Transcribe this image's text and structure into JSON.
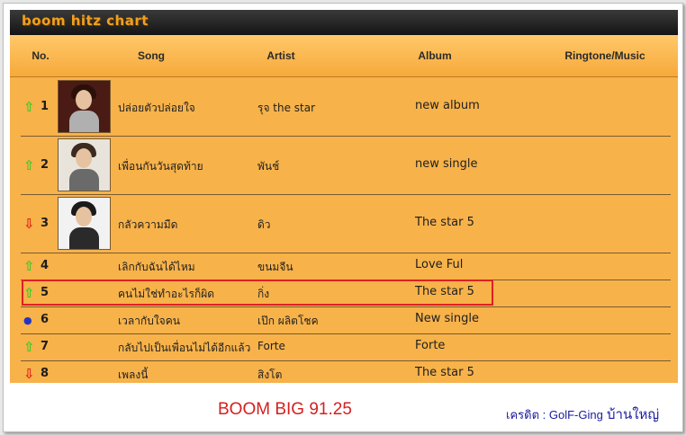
{
  "chart": {
    "title": "boom hitz chart",
    "headers": {
      "no": "No.",
      "song": "Song",
      "artist": "Artist",
      "album": "Album",
      "ringtone": "Ringtone/Music"
    },
    "rows": [
      {
        "trend": "up",
        "trend_glyph": "⇧",
        "rank": "1",
        "song": "ปล่อยตัวปล่อยใจ",
        "artist": "รุจ the star",
        "album": "new album",
        "has_photo": true,
        "photo_icon": "artist-photo"
      },
      {
        "trend": "up",
        "trend_glyph": "⇧",
        "rank": "2",
        "song": "เพื่อนกันวันสุดท้าย",
        "artist": "พันช์",
        "album": "new single",
        "has_photo": true,
        "photo_icon": "artist-photo"
      },
      {
        "trend": "down",
        "trend_glyph": "⇩",
        "rank": "3",
        "song": "กลัวความมืด",
        "artist": "ดิว",
        "album": "The star 5",
        "has_photo": true,
        "photo_icon": "artist-photo"
      },
      {
        "trend": "up",
        "trend_glyph": "⇧",
        "rank": "4",
        "song": "เลิกกับฉันได้ไหม",
        "artist": "ขนมจีน",
        "album": "Love Ful",
        "has_photo": false
      },
      {
        "trend": "up",
        "trend_glyph": "⇧",
        "rank": "5",
        "song": "คนไม่ใช่ทำอะไรก็ผิด",
        "artist": "กิ่ง",
        "album": "The star 5",
        "has_photo": false
      },
      {
        "trend": "same",
        "trend_glyph": "●",
        "rank": "6",
        "song": "เวลากับใจคน",
        "artist": "เป๊ก ผลิตโชค",
        "album": "New single",
        "has_photo": false
      },
      {
        "trend": "up",
        "trend_glyph": "⇧",
        "rank": "7",
        "song": "กลับไปเป็นเพื่อนไม่ได้อีกแล้ว",
        "artist": "Forte",
        "album": "Forte",
        "has_photo": false
      },
      {
        "trend": "down",
        "trend_glyph": "⇩",
        "rank": "8",
        "song": "เพลงนี้",
        "artist": "สิงโต",
        "album": "The star 5",
        "has_photo": false
      }
    ]
  },
  "footer": {
    "station": "BOOM BIG 91.25",
    "credit_label": "เครดิต",
    "credit_sep": " : ",
    "credit_name": "GolF-Ging",
    "credit_place": " บ้านใหญ่"
  },
  "colors": {
    "trend_up": "#44c828",
    "trend_down": "#e2281a",
    "trend_same": "#2235c4",
    "highlight_border": "#e02020",
    "station_text": "#d42020",
    "credit_text": "#1a1aa0"
  }
}
